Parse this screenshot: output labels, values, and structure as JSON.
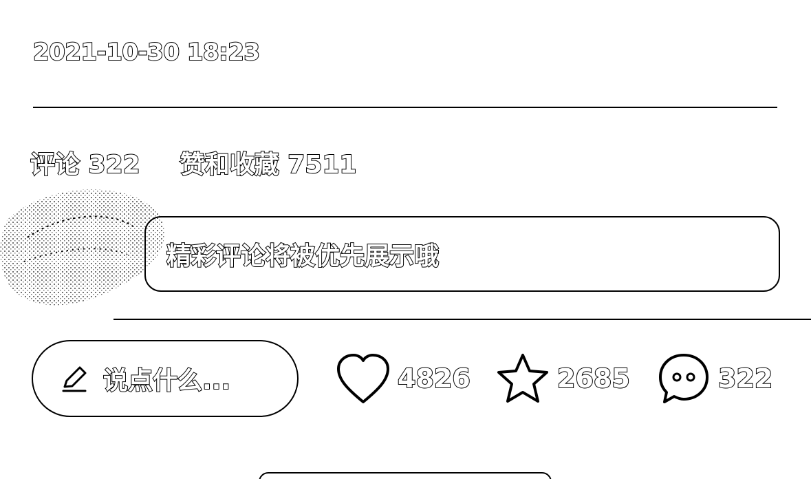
{
  "post": {
    "timestamp": "2021-10-30 18:23"
  },
  "stats": {
    "comments_label": "评论 322",
    "likes_collects_label": "赞和收藏 7511"
  },
  "comment_prompt": {
    "placeholder": "精彩评论将被优先展示哦"
  },
  "bottom_bar": {
    "input_placeholder": "说点什么...",
    "pen_icon": "pen-icon",
    "like": {
      "icon": "heart-icon",
      "count": "4826"
    },
    "collect": {
      "icon": "star-icon",
      "count": "2685"
    },
    "comment": {
      "icon": "chat-bubble-icon",
      "count": "322"
    }
  }
}
